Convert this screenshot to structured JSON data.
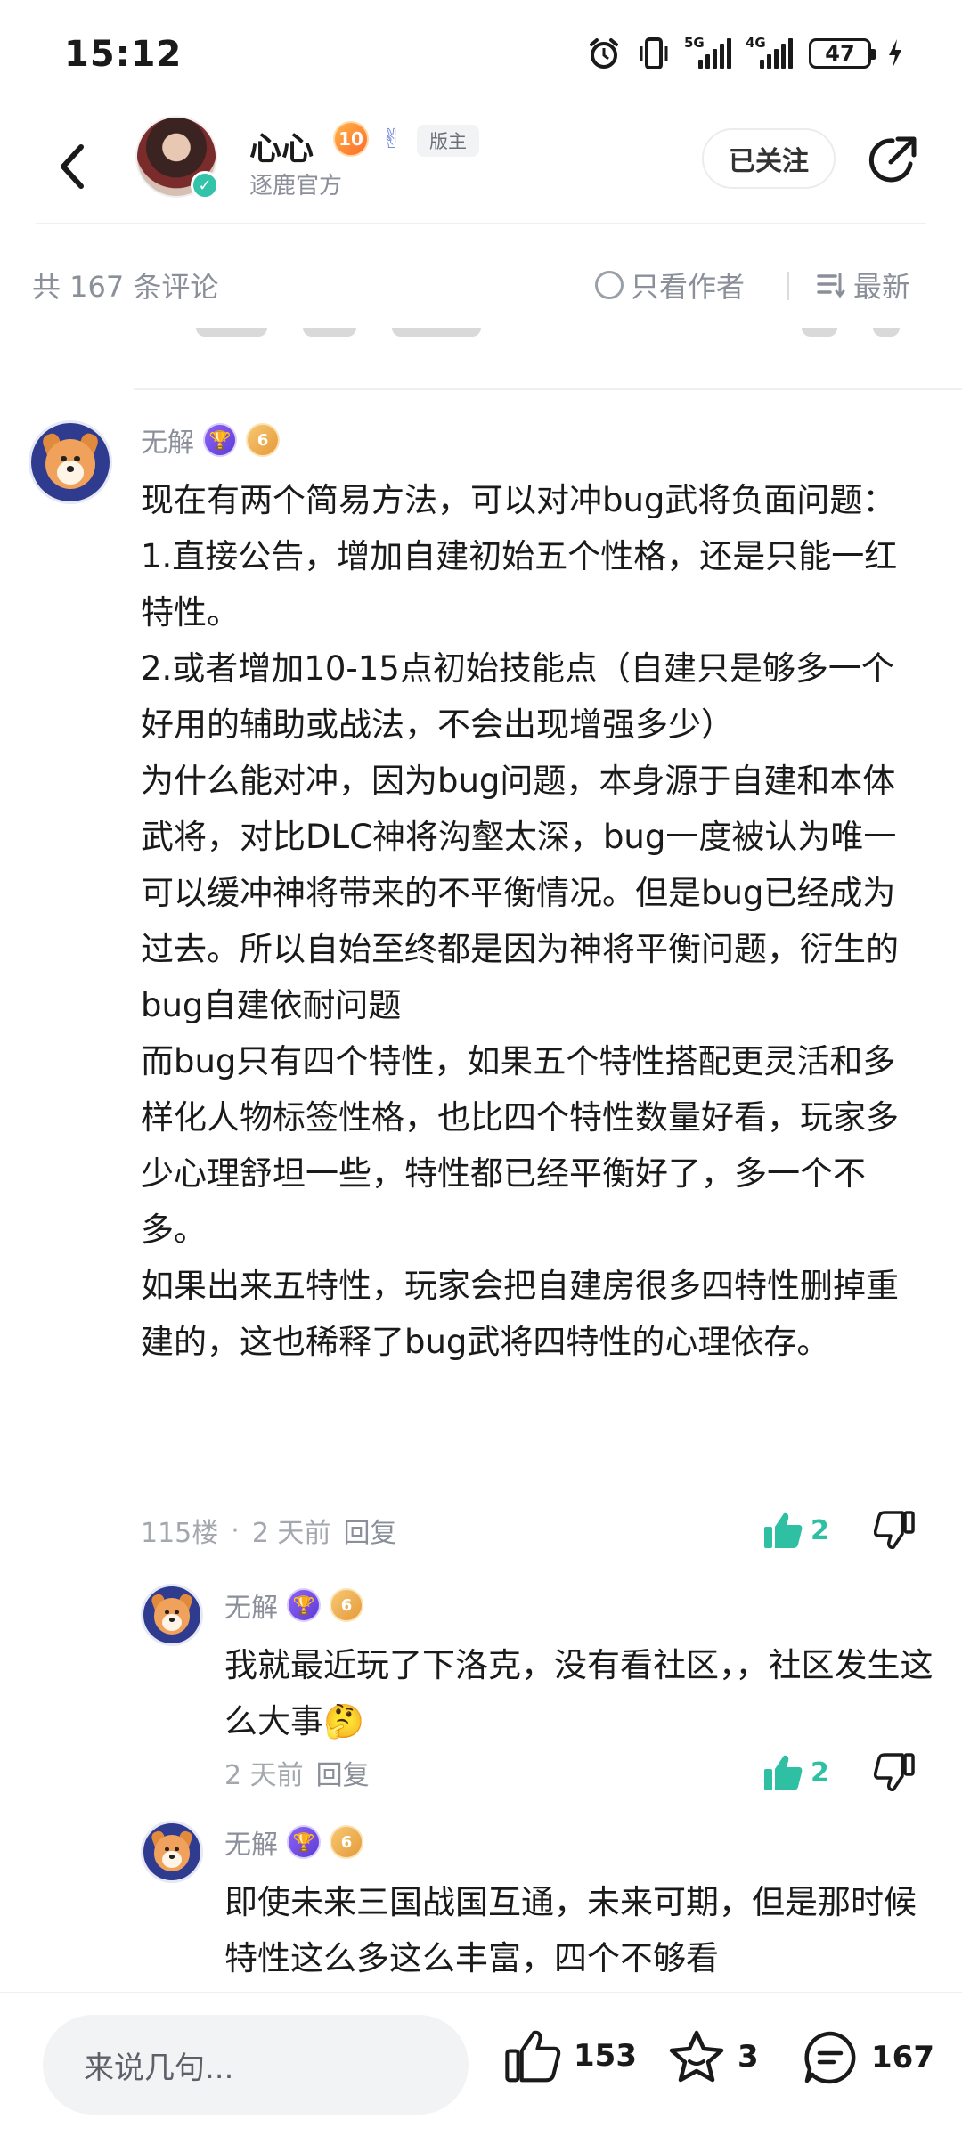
{
  "status_bar": {
    "time": "15:12",
    "network1": "5G",
    "network2": "4G",
    "battery": "47",
    "icons": [
      "alarm-icon",
      "vibrate-icon",
      "signal-5g-icon",
      "signal-4g-icon",
      "battery-icon",
      "charging-icon"
    ]
  },
  "header": {
    "author_name": "心心",
    "level": "10",
    "moderator_tag": "版主",
    "subtitle": "逐鹿官方",
    "follow_label": "已关注"
  },
  "filter": {
    "count_text": "共 167 条评论",
    "only_author": "只看作者",
    "sort_label": "最新"
  },
  "comment": {
    "user": "无解",
    "level": "6",
    "paragraphs": [
      "现在有两个简易方法，可以对冲bug武将负面问题：",
      "1.直接公告，增加自建初始五个性格，还是只能一红特性。",
      "2.或者增加10-15点初始技能点（自建只是够多一个好用的辅助或战法，不会出现增强多少）",
      "为什么能对冲，因为bug问题，本身源于自建和本体武将，对比DLC神将沟壑太深，bug一度被认为唯一可以缓冲神将带来的不平衡情况。但是bug已经成为过去。所以自始至终都是因为神将平衡问题，衍生的bug自建依耐问题",
      "而bug只有四个特性，如果五个特性搭配更灵活和多样化人物标签性格，也比四个特性数量好看，玩家多少心理舒坦一些，特性都已经平衡好了，多一个不多。",
      "如果出来五特性，玩家会把自建房很多四特性删掉重建的，这也稀释了bug武将四特性的心理依存。"
    ],
    "floor": "115楼",
    "time": "2 天前",
    "reply_label": "回复",
    "likes": "2"
  },
  "replies": [
    {
      "user": "无解",
      "level": "6",
      "text": "我就最近玩了下洛克，没有看社区，，社区发生这么大事",
      "emoji": "🤔",
      "time": "2 天前",
      "reply_label": "回复",
      "likes": "2"
    },
    {
      "user": "无解",
      "level": "6",
      "text": "即使未来三国战国互通，未来可期，但是那时候特性这么多这么丰富，四个不够看"
    }
  ],
  "bottom": {
    "input_placeholder": "来说几句...",
    "like_count": "153",
    "favorite_count": "3",
    "comment_count": "167"
  },
  "colors": {
    "accent_green": "#2fbfa2",
    "muted_text": "#8a8f99",
    "input_bg": "#f2f3f5"
  }
}
